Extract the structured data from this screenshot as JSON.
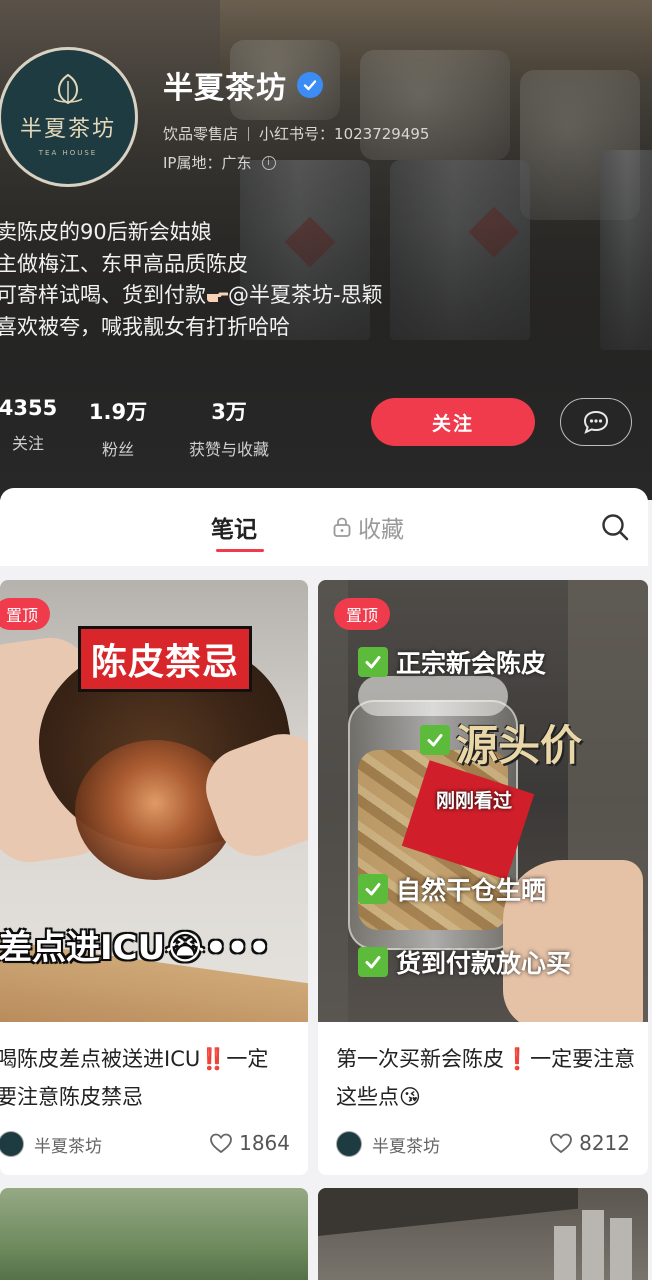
{
  "profile": {
    "name": "半夏茶坊",
    "avatar_text": "半夏茶坊",
    "avatar_subtext": "TEA HOUSE",
    "category": "饮品零售店",
    "red_id_label": "小红书号：",
    "red_id": "1023729495",
    "ip_label": "IP属地：",
    "ip_location": "广东",
    "bio": [
      "卖陈皮的90后新会姑娘",
      "主做梅江、东甲高品质陈皮",
      "可寄样试喝、货到付款",
      "喜欢被夸，喊我靓女有打折哈哈"
    ],
    "bio_mention": "@半夏茶坊-思颖"
  },
  "stats": [
    {
      "value": "4355",
      "label": "关注"
    },
    {
      "value": "1.9万",
      "label": "粉丝"
    },
    {
      "value": "3万",
      "label": "获赞与收藏"
    }
  ],
  "actions": {
    "follow_label": "关注"
  },
  "tabs": {
    "notes_label": "笔记",
    "favorites_label": "收藏",
    "active": "笔记"
  },
  "notes": [
    {
      "badge": "置顶",
      "image_title": "陈皮禁忌",
      "image_caption": "差点进ICU😭•••",
      "title": "喝陈皮差点被送进ICU‼️一定要注意陈皮禁忌",
      "author": "半夏茶坊",
      "likes": "1864"
    },
    {
      "badge": "置顶",
      "image_lines": [
        "正宗新会陈皮",
        "源头价",
        "自然干仓生晒",
        "货到付款放心买"
      ],
      "image_overlay": "刚刚看过",
      "title": "第一次买新会陈皮❗一定要注意这些点😘",
      "author": "半夏茶坊",
      "likes": "8212"
    }
  ],
  "colors": {
    "accent": "#ef3b4c",
    "verified": "#3b8cf5",
    "header_bg": "#2d2c2b"
  },
  "icons": [
    "verified-icon",
    "info-icon",
    "chat-icon",
    "lock-icon",
    "search-icon",
    "heart-icon",
    "check-icon"
  ]
}
